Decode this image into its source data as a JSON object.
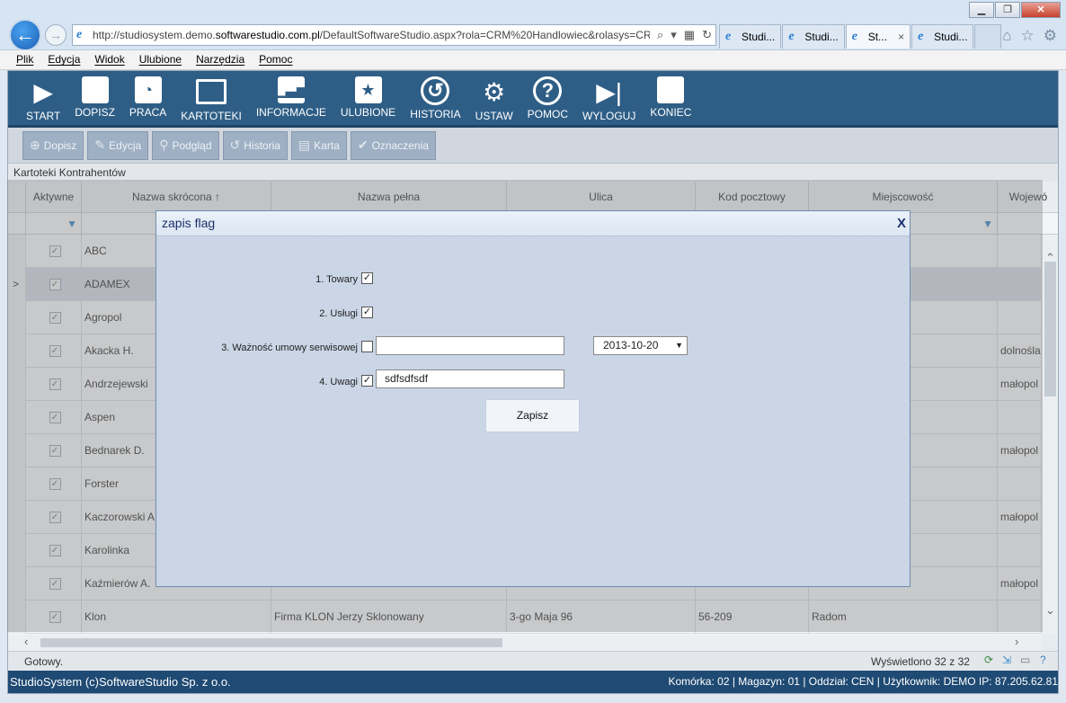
{
  "browser": {
    "url_prefix": "http://studiosystem.demo.",
    "url_domain": "softwarestudio.com.pl",
    "url_rest": "/DefaultSoftwareStudio.aspx?rola=CRM%20Handlowiec&rolasys=CR",
    "tabs": [
      {
        "label": "Studi...",
        "active": false
      },
      {
        "label": "Studi...",
        "active": false
      },
      {
        "label": "St...",
        "active": true
      },
      {
        "label": "Studi...",
        "active": false
      }
    ],
    "tab_close": "×",
    "menu": [
      "Plik",
      "Edycja",
      "Widok",
      "Ulubione",
      "Narzędzia",
      "Pomoc"
    ]
  },
  "toolbar": [
    {
      "label": "START",
      "icon": "play-icon"
    },
    {
      "label": "DOPISZ",
      "icon": "document-icon"
    },
    {
      "label": "PRACA",
      "icon": "gauge-icon"
    },
    {
      "label": "KARTOTEKI",
      "icon": "screen-icon"
    },
    {
      "label": "INFORMACJE",
      "icon": "chart-icon"
    },
    {
      "label": "ULUBIONE",
      "icon": "star-icon"
    },
    {
      "label": "HISTORIA",
      "icon": "history-icon"
    },
    {
      "label": "USTAW",
      "icon": "gears-icon"
    },
    {
      "label": "POMOC",
      "icon": "help-icon"
    },
    {
      "label": "WYLOGUJ",
      "icon": "logout-icon"
    },
    {
      "label": "KONIEC",
      "icon": "stop-icon"
    }
  ],
  "actions": [
    {
      "label": "Dopisz",
      "icon": "plus-icon"
    },
    {
      "label": "Edycja",
      "icon": "edit-icon"
    },
    {
      "label": "Podgląd",
      "icon": "magnifier-icon"
    },
    {
      "label": "Historia",
      "icon": "history-icon"
    },
    {
      "label": "Karta",
      "icon": "card-icon"
    },
    {
      "label": "Oznaczenia",
      "icon": "check-icon"
    }
  ],
  "section_title": "Kartoteki Kontrahentów",
  "grid": {
    "columns": [
      "Aktywne",
      "Nazwa skrócona ↑",
      "Nazwa pełna",
      "Ulica",
      "Kod pocztowy",
      "Miejscowość",
      "Wojewó"
    ],
    "rows": [
      {
        "short": "ABC",
        "full": "",
        "street": "",
        "zip": "",
        "city": "",
        "region": ""
      },
      {
        "short": "ADAMEX",
        "full": "",
        "street": "",
        "zip": "",
        "city": "",
        "region": ""
      },
      {
        "short": "Agropol",
        "full": "",
        "street": "",
        "zip": "",
        "city": "",
        "region": ""
      },
      {
        "short": "Akacka H.",
        "full": "",
        "street": "",
        "zip": "",
        "city": "",
        "region": "dolnośla"
      },
      {
        "short": "Andrzejewski",
        "full": "",
        "street": "",
        "zip": "",
        "city": "",
        "region": "małopol"
      },
      {
        "short": "Aspen",
        "full": "",
        "street": "",
        "zip": "",
        "city": "",
        "region": ""
      },
      {
        "short": "Bednarek D.",
        "full": "",
        "street": "",
        "zip": "",
        "city": "",
        "region": "małopol"
      },
      {
        "short": "Forster",
        "full": "",
        "street": "",
        "zip": "",
        "city": "",
        "region": ""
      },
      {
        "short": "Kaczorowski A",
        "full": "",
        "street": "",
        "zip": "",
        "city": "",
        "region": "małopol"
      },
      {
        "short": "Karolinka",
        "full": "",
        "street": "",
        "zip": "",
        "city": "",
        "region": ""
      },
      {
        "short": "Kaźmierów A.",
        "full": "",
        "street": "",
        "zip": "",
        "city": "",
        "region": "małopol"
      },
      {
        "short": "Klon",
        "full": "Firma KLON Jerzy Sklonowany",
        "street": "3-go Maja 96",
        "zip": "56-209",
        "city": "Radom",
        "region": ""
      }
    ],
    "selected_row_marker": ">"
  },
  "status": {
    "left": "Gotowy.",
    "right": "Wyświetlono 32 z 32"
  },
  "footer": {
    "left": "StudioSystem (c)SoftwareStudio Sp. z o.o.",
    "right": "Komórka: 02 | Magazyn: 01 | Oddział: CEN | Użytkownik: DEMO IP: 87.205.62.81"
  },
  "modal": {
    "title": "zapis flag",
    "close": "X",
    "fields": [
      {
        "label": "1. Towary",
        "checked": true
      },
      {
        "label": "2. Usługi",
        "checked": true
      },
      {
        "label": "3. Ważność umowy serwisowej",
        "checked": false,
        "input_value": "",
        "date": "2013-10-20"
      },
      {
        "label": "4. Uwagi",
        "checked": true,
        "input_value": "sdfsdfsdf"
      }
    ],
    "save_label": "Zapisz"
  }
}
